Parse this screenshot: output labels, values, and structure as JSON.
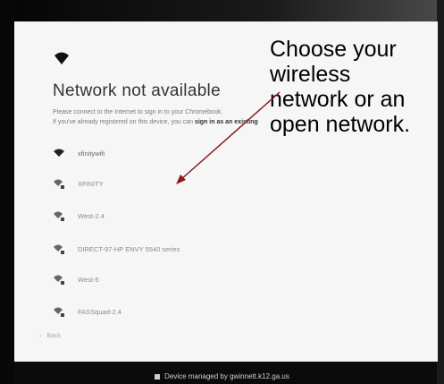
{
  "header": {
    "wifi_icon": "wifi-icon",
    "title": "Network not available"
  },
  "description": {
    "line1": "Please connect to the Internet to sign in to your Chromebook.",
    "line2_prefix": "If you've already registered on this device, you can ",
    "line2_bold": "sign in as an existing"
  },
  "networks": [
    {
      "label": "xfinitywifi",
      "icon": "wifi-open-icon",
      "locked": false
    },
    {
      "label": "XFINITY",
      "icon": "wifi-secured-icon",
      "locked": true
    },
    {
      "label": "West-2.4",
      "icon": "wifi-secured-icon",
      "locked": true
    },
    {
      "label": "DIRECT-97-HP ENVY 5540 series",
      "icon": "wifi-secured-icon",
      "locked": true
    },
    {
      "label": "West-5",
      "icon": "wifi-secured-icon",
      "locked": true
    },
    {
      "label": "FASSquad-2.4",
      "icon": "wifi-secured-icon",
      "locked": true
    }
  ],
  "back_button": {
    "label": "Back",
    "icon": "chevron-left-icon"
  },
  "annotation": {
    "lines": [
      "Choose your",
      "wireless",
      "network or an",
      "open network."
    ],
    "arrow_color": "#8b1a1a"
  },
  "footer": {
    "text": "Device managed by gwinnett.k12.ga.us",
    "icon": "building-icon"
  }
}
